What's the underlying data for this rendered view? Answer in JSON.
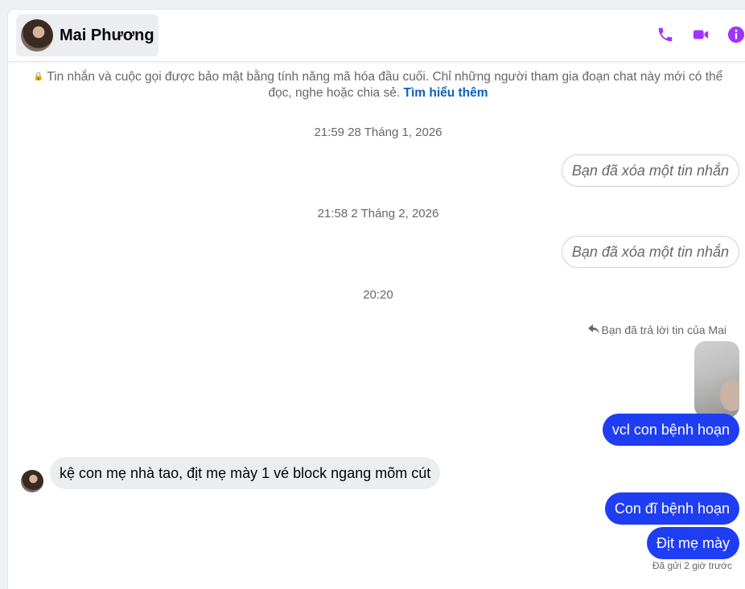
{
  "header": {
    "contact_name": "Mai Phương",
    "actions": [
      {
        "name": "voice-call",
        "icon": "phone-icon"
      },
      {
        "name": "video-call",
        "icon": "video-icon"
      },
      {
        "name": "info",
        "icon": "info-icon"
      }
    ],
    "accent_color": "#a033ff"
  },
  "notice": {
    "text": "Tin nhắn và cuộc gọi được bảo mật bằng tính năng mã hóa đầu cuối. Chỉ những người tham gia đoạn chat này mới có thể đọc, nghe hoặc chia sẻ.",
    "link": "Tìm hiểu thêm"
  },
  "messages": {
    "ts1": "21:59 28 Tháng 1, 2026",
    "deleted1": "Bạn đã xóa một tin nhắn",
    "ts2": "21:58 2 Tháng 2, 2026",
    "deleted2": "Bạn đã xóa một tin nhắn",
    "ts3": "20:20",
    "reply_note": "Bạn đã trả lời tin của Mai",
    "out1": "vcl con bệnh hoạn",
    "in1": "kệ con mẹ nhà tao, địt mẹ mày 1 vé block ngang mõm cút",
    "out2": "Con đĩ bệnh hoạn",
    "out3": "Địt mẹ mày",
    "seen_partial": "Đã gửi 2 giờ trước"
  },
  "colors": {
    "outgoing_bubble": "#1f3df2",
    "incoming_bubble": "#ebedf0",
    "link": "#0a5fbf"
  }
}
